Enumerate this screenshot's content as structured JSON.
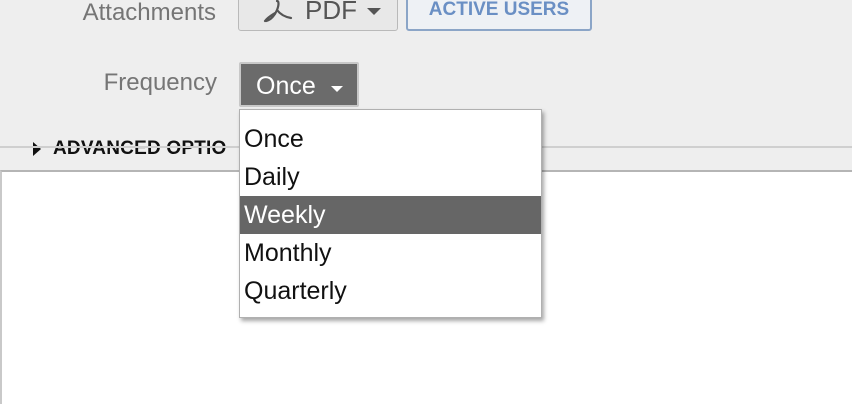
{
  "form": {
    "attachments_label": "Attachments",
    "frequency_label": "Frequency",
    "pdf_button_label": "PDF",
    "active_users_label": "ACTIVE USERS",
    "frequency_value": "Once",
    "advanced_options_label": "ADVANCED OPTIO"
  },
  "dropdown": {
    "options": [
      "Once",
      "Daily",
      "Weekly",
      "Monthly",
      "Quarterly"
    ],
    "highlighted": "Weekly"
  },
  "icons": {
    "pdf": "adobe-pdf-icon",
    "pdf_caret": "chevron-down-icon",
    "frequency_caret": "chevron-down-icon",
    "advanced_toggle": "triangle-right-icon"
  },
  "colors": {
    "background": "#eeeeee",
    "label_text": "#757575",
    "active_users_accent": "#6a8fc4",
    "selected_fill": "#666666",
    "select_fill": "#6b6b6b"
  }
}
